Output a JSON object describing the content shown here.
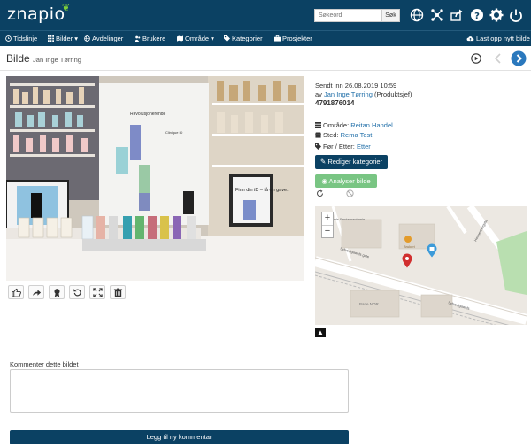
{
  "app": {
    "logo_text": "znapio"
  },
  "search": {
    "placeholder": "Søkeord",
    "button_label": "Søk"
  },
  "nav": {
    "items": [
      {
        "label": "Tidslinje"
      },
      {
        "label": "Bilder",
        "dropdown": true
      },
      {
        "label": "Avdelinger"
      },
      {
        "label": "Brukere"
      },
      {
        "label": "Område",
        "dropdown": true
      },
      {
        "label": "Kategorier"
      },
      {
        "label": "Prosjekter"
      }
    ],
    "upload_label": "Last opp nytt bilde"
  },
  "page": {
    "title": "Bilde",
    "subtitle": "Jan Inge Tørring"
  },
  "photo": {
    "poster_heading": "Revolusjonerende",
    "display_text": "Finn din iD – få en gave.",
    "small_sign_text": "Finn din iD"
  },
  "info": {
    "sent_label": "Sendt inn 26.08.2019 10:59",
    "by_prefix": "av",
    "author": "Jan Inge Tørring",
    "role": "(Produktsjef)",
    "id_number": "4791876014",
    "area_label": "Område:",
    "area_value": "Reitan Handel",
    "place_label": "Sted:",
    "place_value": "Rema Test",
    "before_after_label": "Før / Etter:",
    "before_after_value": "Etter",
    "edit_category_button": "Rediger kategorier",
    "analyze_button": "Analyser bilde"
  },
  "map": {
    "zoom_in": "+",
    "zoom_out": "−",
    "labels": {
      "restaurant": "Faris Restaurantmeie",
      "street1": "Schweigaards gate",
      "street2": "Holmenbergata",
      "street3": "Schweigaards",
      "area": "Bane NOR",
      "shop": "Brukeri"
    }
  },
  "comment": {
    "label": "Kommenter dette bildet",
    "placeholder": "",
    "submit_label": "Legg til ny kommentar"
  },
  "colors": {
    "brand": "#0b4163",
    "green": "#79c583",
    "link": "#1f6ea8"
  },
  "icons": [
    "globe-icon",
    "network-icon",
    "share-icon",
    "help-icon",
    "gear-icon",
    "power-icon"
  ]
}
